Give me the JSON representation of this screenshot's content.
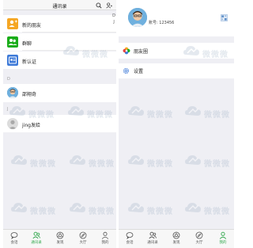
{
  "contacts_screen": {
    "title": "通讯录",
    "rows": [
      {
        "label": "新的朋友",
        "color": "#f5a623",
        "icon": "person-plus-icon"
      },
      {
        "label": "群聊",
        "color": "#1aad19",
        "icon": "group-icon"
      },
      {
        "label": "新认证",
        "color": "#3e7ad8",
        "icon": "badge-icon"
      }
    ],
    "sections": [
      {
        "letter": "D",
        "contact": "邵翔奇"
      },
      {
        "letter": "J",
        "contact": "jing发给"
      }
    ],
    "index_letters": [
      "D",
      "J"
    ]
  },
  "profile_screen": {
    "account_label": "账号: 123456",
    "menu": [
      {
        "label": "朋友圈",
        "icon": "photos-icon"
      },
      {
        "label": "设置",
        "icon": "settings-icon"
      }
    ]
  },
  "tabbar": {
    "tabs": [
      {
        "label": "会话",
        "icon": "chat-icon"
      },
      {
        "label": "通讯录",
        "icon": "contacts-icon"
      },
      {
        "label": "发现",
        "icon": "discover-icon"
      },
      {
        "label": "大厅",
        "icon": "compass-icon"
      },
      {
        "label": "我的",
        "icon": "me-icon"
      }
    ],
    "left_active_index": 1,
    "right_active_index": 4,
    "active_color": "#2fa74b"
  },
  "watermark": {
    "text": "微微微"
  }
}
